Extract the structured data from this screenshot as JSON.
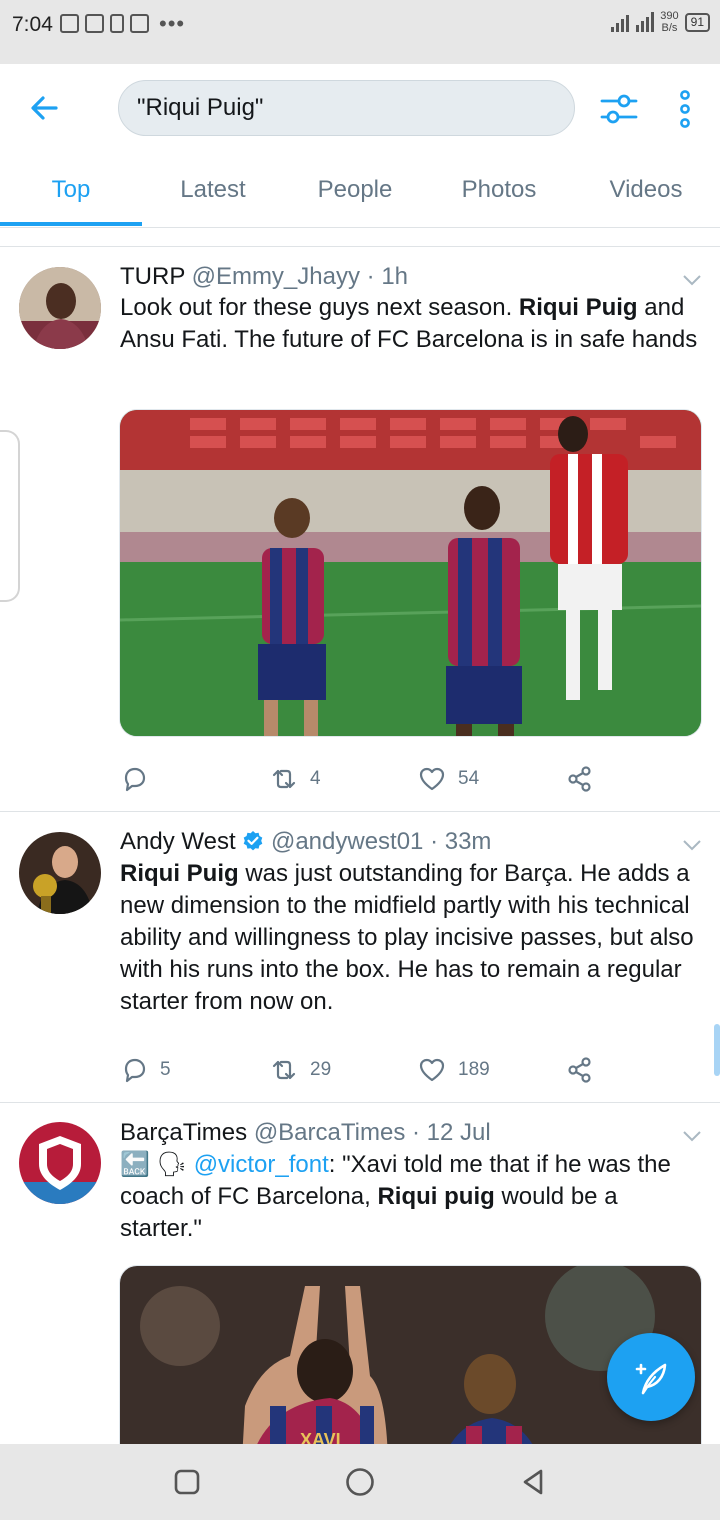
{
  "status_bar": {
    "time": "7:04",
    "net_rate_value": "390",
    "net_rate_unit": "B/s",
    "battery": "91"
  },
  "search": {
    "query": "\"Riqui Puig\""
  },
  "tabs": [
    {
      "label": "Top",
      "active": true
    },
    {
      "label": "Latest",
      "active": false
    },
    {
      "label": "People",
      "active": false
    },
    {
      "label": "Photos",
      "active": false
    },
    {
      "label": "Videos",
      "active": false
    }
  ],
  "tweets": [
    {
      "name": "TURP",
      "handle": "@Emmy_Jhayy",
      "time": "· 1h",
      "verified": false,
      "text": [
        {
          "t": "Look out for these guys next season. "
        },
        {
          "t": "Riqui Puig",
          "bold": true
        },
        {
          "t": " and Ansu Fati. The future of FC Barcelona is in safe hands"
        }
      ],
      "replies": "",
      "retweets": "4",
      "likes": "54"
    },
    {
      "name": "Andy West",
      "handle": "@andywest01",
      "time": "· 33m",
      "verified": true,
      "text": [
        {
          "t": "Riqui Puig",
          "bold": true
        },
        {
          "t": " was just outstanding for Barça. He adds a new dimension to the midfield partly with his technical ability and willingness to play incisive passes, but also with his runs into the box. He has to remain a regular starter from now on."
        }
      ],
      "replies": "5",
      "retweets": "29",
      "likes": "189"
    },
    {
      "name": "BarçaTimes",
      "handle": "@BarcaTimes",
      "time": "· 12 Jul",
      "verified": false,
      "text": [
        {
          "t": "🔙 🗣 ",
          "emoji": true
        },
        {
          "t": "@victor_font",
          "mention": true
        },
        {
          "t": ": \"Xavi told me that if he was the coach of FC Barcelona, "
        },
        {
          "t": "Riqui puig",
          "bold": true
        },
        {
          "t": " would be a starter.\""
        }
      ],
      "photo_caption": "XAVI"
    }
  ],
  "colors": {
    "accent": "#1da1f2",
    "text": "#14171a",
    "secondary": "#657786"
  }
}
